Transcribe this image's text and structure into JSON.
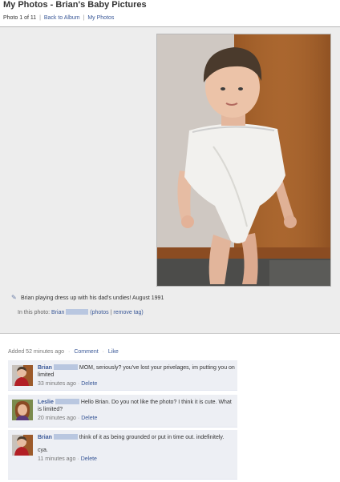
{
  "header": {
    "title": "My Photos - Brian's Baby Pictures",
    "photo_counter": "Photo 1 of 11",
    "back_to_album": "Back to Album",
    "my_photos": "My Photos",
    "separator": "|"
  },
  "photo": {
    "caption": "Brian playing dress up with his dad's undies! August 1991",
    "in_this_photo_label": "In this photo:",
    "tagged_name": "Brian",
    "photos_link": "(photos",
    "remove_tag_link": "remove tag)",
    "separator": "|"
  },
  "activity": {
    "added": "Added 52 minutes ago",
    "comment_link": "Comment",
    "like_link": "Like",
    "dot": "·"
  },
  "comments": [
    {
      "author": "Brian",
      "text": "MOM, seriously? you've lost your privelages, im putting you on limited",
      "time": "33 minutes ago",
      "delete": "Delete"
    },
    {
      "author": "Leslie",
      "text": "Hello Brian. Do you not like the photo? I think it is cute. What is limited?",
      "time": "20 minutes ago",
      "delete": "Delete"
    },
    {
      "author": "Brian",
      "text": "think of it as being grounded or put in time out. indefinitely.",
      "text2": "cya.",
      "time": "11 minutes ago",
      "delete": "Delete"
    }
  ],
  "icons": {
    "pencil": "pencil-icon"
  }
}
